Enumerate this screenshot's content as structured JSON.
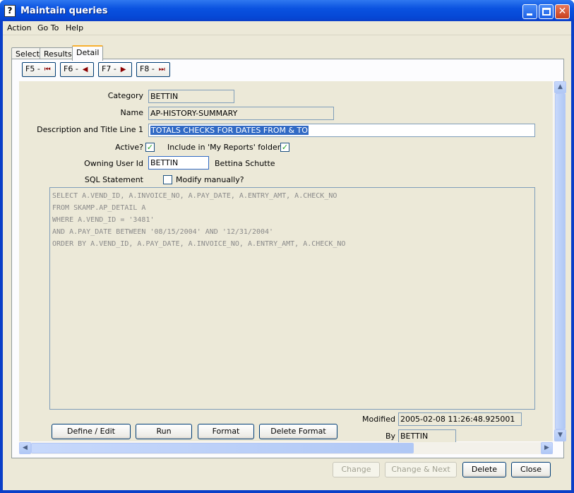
{
  "window": {
    "title": "Maintain queries",
    "app_icon": "question-icon"
  },
  "menu": {
    "items": [
      {
        "label": "Action"
      },
      {
        "label": "Go To"
      },
      {
        "label": "Help"
      }
    ]
  },
  "tabs": [
    {
      "label": "Select"
    },
    {
      "label": "Results"
    },
    {
      "label": "Detail"
    }
  ],
  "active_tab": "Detail",
  "nav_buttons": [
    {
      "key": "F5 -",
      "icon": "first-record-icon",
      "glyph": "⏮"
    },
    {
      "key": "F6 -",
      "icon": "previous-record-icon",
      "glyph": "◀"
    },
    {
      "key": "F7 -",
      "icon": "next-record-icon",
      "glyph": "▶"
    },
    {
      "key": "F8 -",
      "icon": "last-record-icon",
      "glyph": "⏭"
    }
  ],
  "form": {
    "category_label": "Category",
    "category_value": "BETTIN",
    "name_label": "Name",
    "name_value": "AP-HISTORY-SUMMARY",
    "description_label": "Description and Title Line 1",
    "description_value": "TOTALS CHECKS FOR DATES FROM & TO",
    "active_label": "Active?",
    "active_checked": true,
    "my_reports_label": "Include in 'My Reports' folder?",
    "my_reports_checked": true,
    "owner_label": "Owning User Id",
    "owner_value": "BETTIN",
    "owner_name": "Bettina Schutte",
    "sql_label": "SQL Statement",
    "modify_label": "Modify manually?",
    "modify_checked": false,
    "sql_text": "SELECT A.VEND_ID, A.INVOICE_NO, A.PAY_DATE, A.ENTRY_AMT, A.CHECK_NO\nFROM SKAMP.AP_DETAIL A\nWHERE A.VEND_ID = '3481'\nAND A.PAY_DATE BETWEEN '08/15/2004' AND '12/31/2004'\nORDER BY A.VEND_ID, A.PAY_DATE, A.INVOICE_NO, A.ENTRY_AMT, A.CHECK_NO",
    "modified_label": "Modified",
    "modified_value": "2005-02-08 11:26:48.925001",
    "by_label": "By",
    "by_value": "BETTIN"
  },
  "inner_buttons": {
    "define_edit": "Define / Edit",
    "run": "Run",
    "format": "Format",
    "delete_format": "Delete Format"
  },
  "bottom_buttons": {
    "change": "Change",
    "change_next": "Change & Next",
    "delete": "Delete",
    "close": "Close"
  },
  "check_glyph": "✓"
}
